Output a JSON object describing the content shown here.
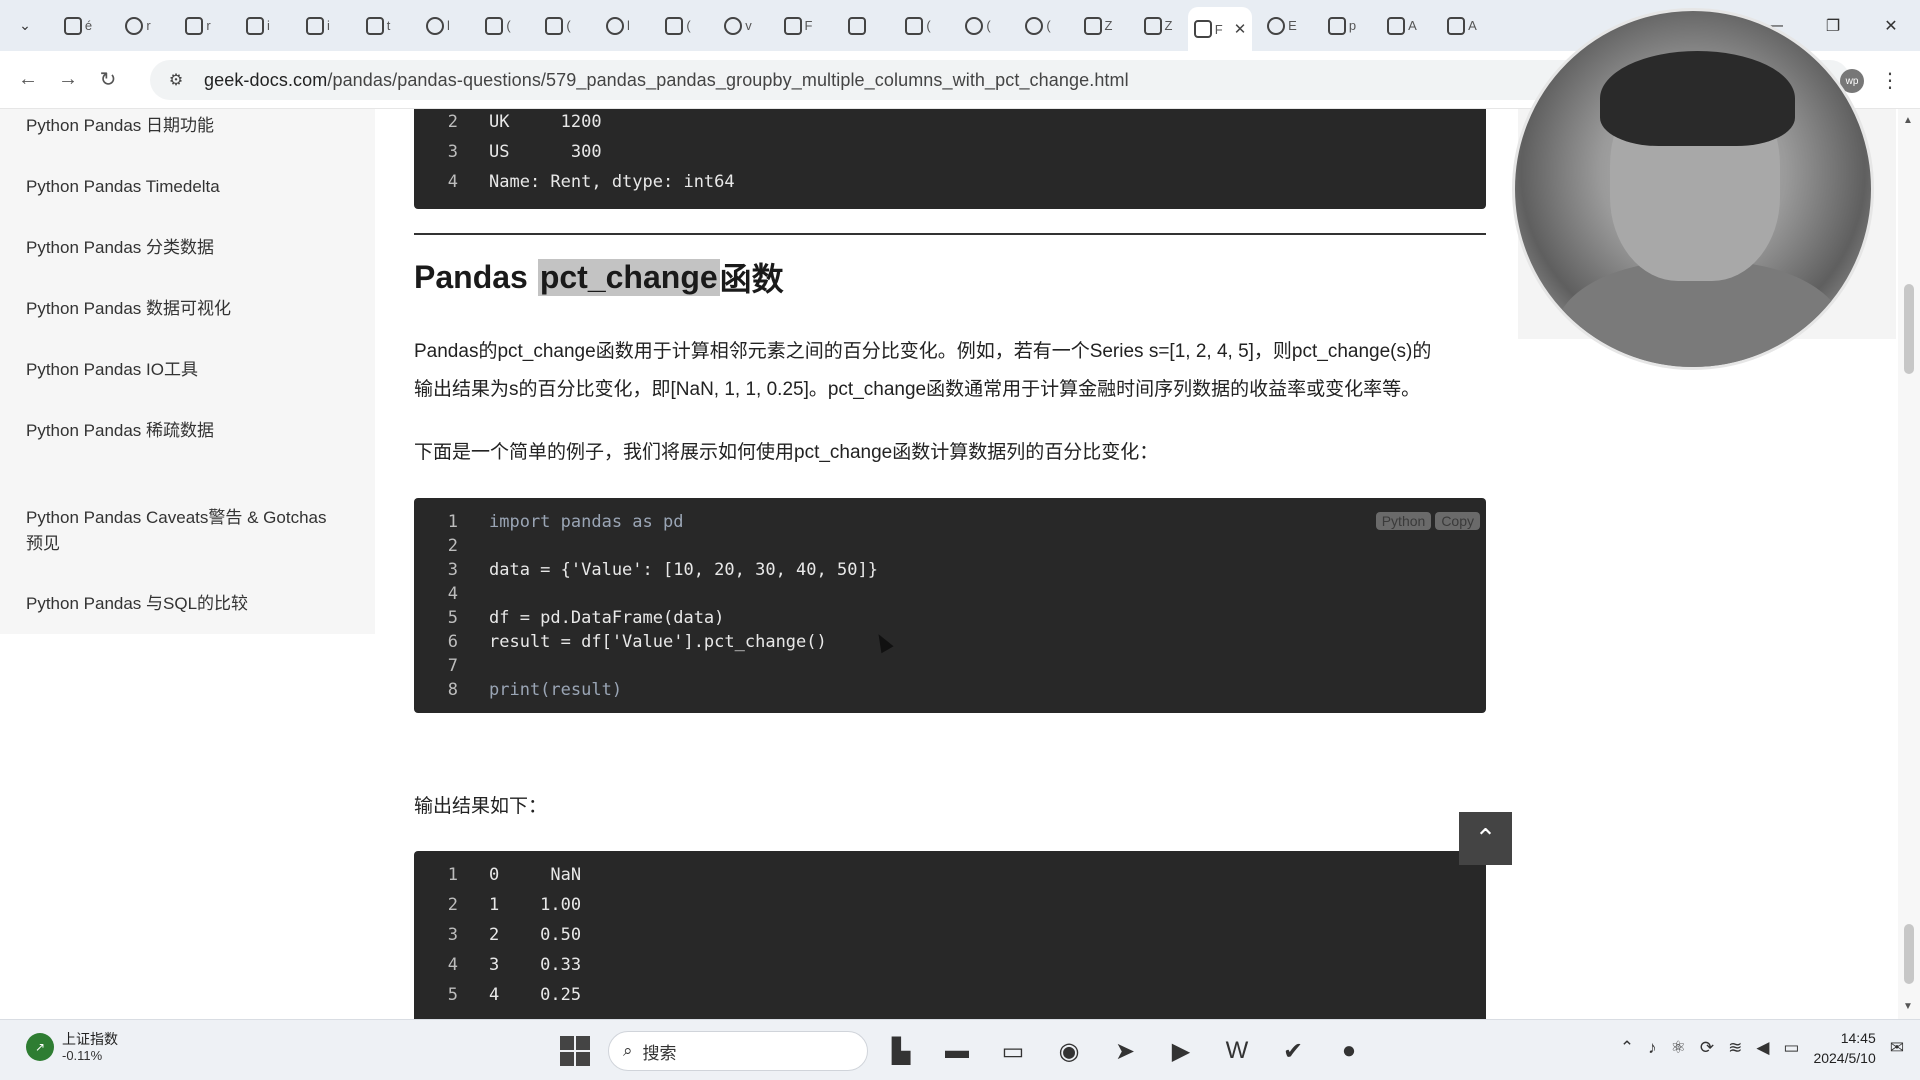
{
  "browser": {
    "tabs": [
      {
        "icon": "robot-icon",
        "label": "é"
      },
      {
        "icon": "github-icon",
        "label": "r"
      },
      {
        "icon": "c-icon",
        "label": "r"
      },
      {
        "icon": "video-icon",
        "label": "i"
      },
      {
        "icon": "puzzle-icon",
        "label": "i"
      },
      {
        "icon": "image-icon",
        "label": "t"
      },
      {
        "icon": "github-icon",
        "label": "l"
      },
      {
        "icon": "cube-icon",
        "label": "("
      },
      {
        "icon": "video-icon",
        "label": "("
      },
      {
        "icon": "github-icon",
        "label": "l"
      },
      {
        "icon": "grid-icon",
        "label": "("
      },
      {
        "icon": "github-icon",
        "label": "v"
      },
      {
        "icon": "c-icon",
        "label": "F"
      },
      {
        "icon": "cloud-icon",
        "label": ""
      },
      {
        "icon": "cloud-icon",
        "label": "("
      },
      {
        "icon": "github-icon",
        "label": "("
      },
      {
        "icon": "spinner-icon",
        "label": "("
      },
      {
        "icon": "book-icon",
        "label": "Z"
      },
      {
        "icon": "book-icon",
        "label": "Z"
      },
      {
        "icon": "page-icon",
        "label": "F",
        "active": true
      },
      {
        "icon": "globe-icon",
        "label": "E"
      },
      {
        "icon": "c-icon",
        "label": "p"
      },
      {
        "icon": "settings-icon",
        "label": "A"
      },
      {
        "icon": "shield-icon",
        "label": "A"
      }
    ],
    "url_domain": "geek-docs.com",
    "url_path": "/pandas/pandas-questions/579_pandas_pandas_groupby_multiple_columns_with_pct_change.html",
    "ext_label": "wp"
  },
  "sidebar": {
    "items": [
      {
        "label": "Python Pandas 日期功能"
      },
      {
        "label": "Python Pandas Timedelta"
      },
      {
        "label": "Python Pandas 分类数据"
      },
      {
        "label": "Python Pandas 数据可视化"
      },
      {
        "label": "Python Pandas IO工具"
      },
      {
        "label": "Python Pandas 稀疏数据"
      },
      {
        "label": "Python Pandas Caveats警告 & Gotchas 预见"
      },
      {
        "label": "Python Pandas 与SQL的比较"
      }
    ]
  },
  "top_code": {
    "lines": [
      {
        "n": "2",
        "text": "UK     1200"
      },
      {
        "n": "3",
        "text": "US      300"
      },
      {
        "n": "4",
        "text": "Name: Rent, dtype: int64"
      }
    ]
  },
  "section": {
    "heading_prefix": "Pandas ",
    "heading_highlight": "pct_change",
    "heading_suffix": "函数",
    "para1_line1": "Pandas的pct_change函数用于计算相邻元素之间的百分比变化。例如，若有一个Series s=[1, 2, 4, 5]，则pct_change(s)的",
    "para1_line2": "输出结果为s的百分比变化，即[NaN, 1, 1, 0.25]。pct_change函数通常用于计算金融时间序列数据的收益率或变化率等。",
    "para2": "下面是一个简单的例子，我们将展示如何使用pct_change函数计算数据列的百分比变化：",
    "output_label": "输出结果如下："
  },
  "example_code": {
    "lang_badge": "Python",
    "copy_badge": "Copy",
    "lines": [
      {
        "n": "1",
        "text": "import pandas as pd"
      },
      {
        "n": "2",
        "text": ""
      },
      {
        "n": "3",
        "text": "data = {'Value': [10, 20, 30, 40, 50]}"
      },
      {
        "n": "4",
        "text": ""
      },
      {
        "n": "5",
        "text": "df = pd.DataFrame(data)"
      },
      {
        "n": "6",
        "text": "result = df['Value'].pct_change()"
      },
      {
        "n": "7",
        "text": ""
      },
      {
        "n": "8",
        "text": "print(result)"
      }
    ]
  },
  "output_code": {
    "lines": [
      {
        "n": "1",
        "text": "0     NaN"
      },
      {
        "n": "2",
        "text": "1    1.00"
      },
      {
        "n": "3",
        "text": "2    0.50"
      },
      {
        "n": "4",
        "text": "3    0.33"
      },
      {
        "n": "5",
        "text": "4    0.25"
      }
    ]
  },
  "taskbar": {
    "stock_name": "上证指数",
    "stock_change": "-0.11%",
    "search_placeholder": "搜索",
    "time": "14:45",
    "date": "2024/5/10"
  },
  "colors": {
    "code_bg": "#282828",
    "sidebar_bg": "#f6f6f6",
    "highlight": "#c3c3c3"
  }
}
